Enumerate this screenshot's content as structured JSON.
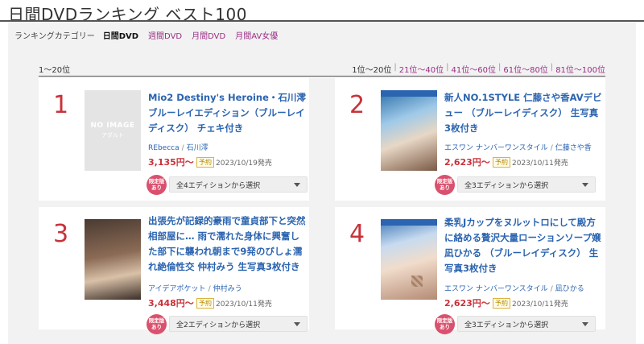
{
  "page": {
    "title": "日間DVDランキング ベスト100"
  },
  "category_bar": {
    "label": "ランキングカテゴリー",
    "items": [
      {
        "label": "日間DVD",
        "active": true
      },
      {
        "label": "週間DVD",
        "active": false
      },
      {
        "label": "月間DVD",
        "active": false
      },
      {
        "label": "月間AV女優",
        "active": false
      }
    ]
  },
  "list": {
    "range_label": "1〜20位",
    "pager": [
      {
        "label": "1位〜20位",
        "current": true
      },
      {
        "label": "21位〜40位",
        "current": false
      },
      {
        "label": "41位〜60位",
        "current": false
      },
      {
        "label": "61位〜80位",
        "current": false
      },
      {
        "label": "81位〜100位",
        "current": false
      }
    ]
  },
  "items": [
    {
      "rank": "1",
      "thumb": {
        "type": "no-image",
        "line1": "NO IMAGE",
        "line2": "アダルト"
      },
      "title": "Mio2 Destiny's Heroine・石川澪 ブルーレイエディション（ブルーレイディスク） チェキ付き",
      "maker": "REbecca",
      "actress": "石川澪",
      "price": "3,135円〜",
      "badge": "予約",
      "release": "2023/10/19発売",
      "limited_line1": "限定版",
      "limited_line2": "あり",
      "edition_select": "全4エディションから選択"
    },
    {
      "rank": "2",
      "thumb": {
        "type": "photo"
      },
      "title": "新人NO.1STYLE 仁藤さや香AVデビュー （ブルーレイディスク） 生写真3枚付き",
      "maker": "エスワン ナンバーワンスタイル",
      "actress": "仁藤さや香",
      "price": "2,623円〜",
      "badge": "予約",
      "release": "2023/10/11発売",
      "limited_line1": "限定版",
      "limited_line2": "あり",
      "edition_select": "全3エディションから選択"
    },
    {
      "rank": "3",
      "thumb": {
        "type": "photo"
      },
      "title": "出張先が記録的豪雨で童貞部下と突然相部屋に… 雨で濡れた身体に興奮した部下に襲われ朝まで9発のびしょ濡れ絶倫性交 仲村みう 生写真3枚付き",
      "maker": "アイデアポケット",
      "actress": "仲村みう",
      "price": "3,448円〜",
      "badge": "予約",
      "release": "2023/10/11発売",
      "limited_line1": "限定版",
      "limited_line2": "あり",
      "edition_select": "全2エディションから選択"
    },
    {
      "rank": "4",
      "thumb": {
        "type": "photo"
      },
      "title": "柔乳Jカップをヌルットロにして殿方に絡める贅沢大量ローションソープ嬢 凪ひかる （ブルーレイディスク） 生写真3枚付き",
      "maker": "エスワン ナンバーワンスタイル",
      "actress": "凪ひかる",
      "price": "2,623円〜",
      "badge": "予約",
      "release": "2023/10/11発売",
      "limited_line1": "限定版",
      "limited_line2": "あり",
      "edition_select": "全3エディションから選択"
    }
  ],
  "colors": {
    "accent_link": "#2b64b0",
    "rank_red": "#c8323a",
    "category_purple": "#9a2d86",
    "limited_pink": "#d9516e"
  }
}
